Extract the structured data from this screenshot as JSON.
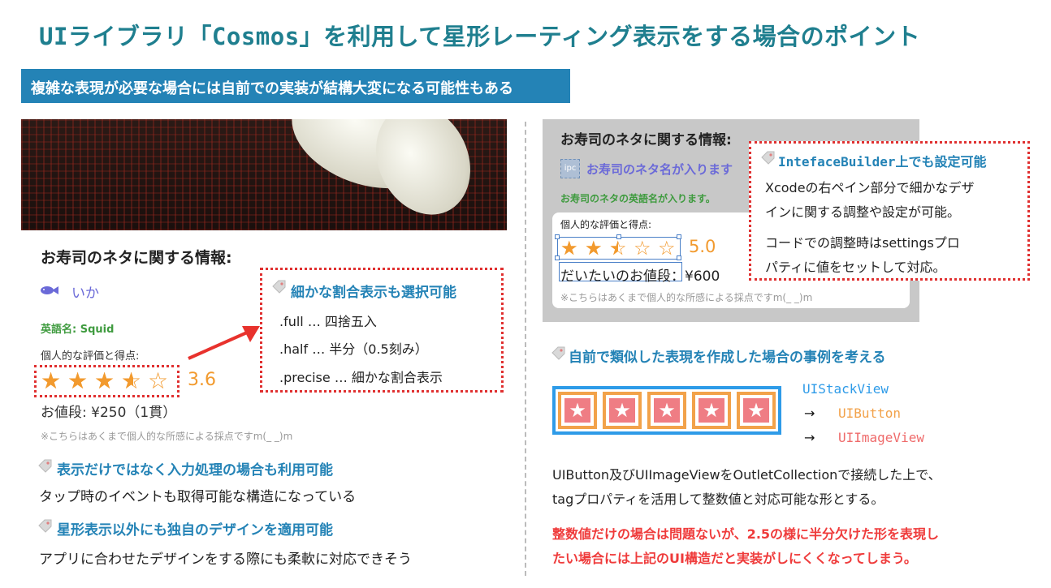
{
  "title": "UIライブラリ「Cosmos」を利用して星形レーティング表示をする場合のポイント",
  "banner": "複雑な表現が必要な場合には自前での実装が結構大変になる可能性もある",
  "left": {
    "info_title": "お寿司のネタに関する情報:",
    "neta_name": "いか",
    "english_name": "英語名: Squid",
    "rating_label": "個人的な評価と得点:",
    "rating": 3.6,
    "score_text": "3.6",
    "price": "お値段: ¥250（1貫）",
    "note": "※こちらはあくまで個人的な所感による採点ですm(_ _)m",
    "box": {
      "title": "細かな割合表示も選択可能",
      "lines": [
        ".full … 四捨五入",
        ".half … 半分（0.5刻み）",
        ".precise … 細かな割合表示"
      ]
    },
    "feature1_title": "表示だけではなく入力処理の場合も利用可能",
    "feature1_desc": "タップ時のイベントも取得可能な構造になっている",
    "feature2_title": "星形表示以外にも独自のデザインを適用可能",
    "feature2_desc": "アプリに合わせたデザインをする際にも柔軟に対応できそう"
  },
  "right": {
    "ib": {
      "info_title": "お寿司のネタに関する情報:",
      "icon_text": "ipc",
      "neta_placeholder": "お寿司のネタ名が入ります",
      "english_placeholder": "お寿司のネタの英語名が入ります。",
      "rating_label": "個人的な評価と得点:",
      "rating": 2.5,
      "score_text": "5.0",
      "price": "だいたいのお値段：¥600",
      "note": "※こちらはあくまで個人的な所感による採点ですm(_ _)m"
    },
    "box": {
      "title": "IntefaceBuilder上でも設定可能",
      "line1": "Xcodeの右ペイン部分で細かなデザ",
      "line2": "インに関する調整や設定が可能。",
      "line3": "コードでの調整時はsettingsプロ",
      "line4": "パティに値をセットして対応。"
    },
    "heading": "自前で類似した表現を作成した場合の事例を考える",
    "legend": {
      "stack": "UIStackView",
      "arrow": "→",
      "button": "UIButton",
      "image": "UIImageView"
    },
    "button_star": "★",
    "desc_line1": "UIButton及びUIImageViewをOutletCollectionで接続した上で、",
    "desc_line2": "tagプロパティを活用して整数値と対応可能な形とする。",
    "warn_line1": "整数値だけの場合は問題ないが、2.5の様に半分欠けた形を表現し",
    "warn_line2": "たい場合には上記のUI構造だと実装がしにくくなってしまう。"
  },
  "colors": {
    "title": "#1f7f8f",
    "banner_bg": "#2483b6",
    "star": "#f29a2e",
    "dotted_border": "#e03030",
    "stackview": "#2e9be8",
    "button": "#f2a24a",
    "imageview": "#ef7d84",
    "warning": "#ef3b3b"
  },
  "icons": {
    "tag": "tag-icon",
    "fish": "fish-icon",
    "arrow": "red-arrow-icon"
  }
}
